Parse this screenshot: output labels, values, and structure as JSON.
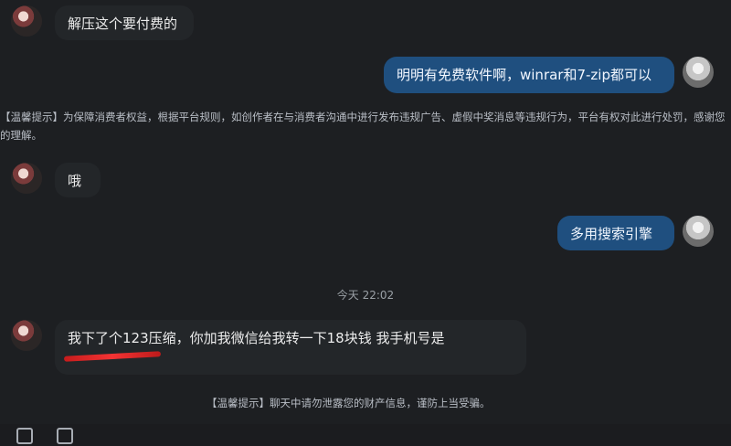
{
  "messages": [
    {
      "side": "left",
      "text": "解压这个要付费的"
    },
    {
      "side": "right",
      "text": "明明有免费软件啊，winrar和7-zip都可以"
    },
    {
      "side": "system",
      "text": "【温馨提示】为保障消费者权益，根据平台规则，如创作者在与消费者沟通中进行发布违规广告、虚假中奖消息等违规行为，平台有权对此进行处罚，感谢您的理解。"
    },
    {
      "side": "left",
      "text": "哦"
    },
    {
      "side": "right",
      "text": "多用搜索引擎"
    },
    {
      "side": "time",
      "text": "今天 22:02"
    },
    {
      "side": "left",
      "text": "我下了个123压缩，你加我微信给我转一下18块钱 我手机号是"
    },
    {
      "side": "system",
      "text": "【温馨提示】聊天中请勿泄露您的财产信息，谨防上当受骗。"
    }
  ]
}
